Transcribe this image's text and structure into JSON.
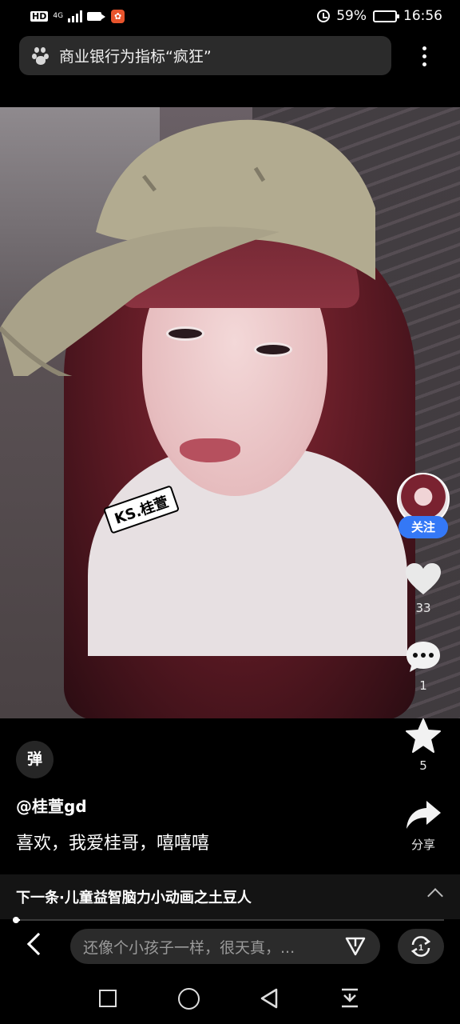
{
  "status_bar": {
    "hd_label": "HD",
    "network_label": "4G",
    "battery": "59%",
    "battery_level": 0.59,
    "time": "16:56"
  },
  "search": {
    "query": "商业银行为指标“疯狂”"
  },
  "video": {
    "sticker_text": "KS.桂萱",
    "eye_tag": "桂萱"
  },
  "rail": {
    "follow_label": "关注",
    "likes": "33",
    "comments": "1",
    "favorites": "5",
    "share_label": "分享"
  },
  "caption": {
    "danmaku_label": "弹",
    "author": "@桂萱gd",
    "text": "喜欢，我爱桂哥，嘻嘻嘻"
  },
  "next_up": {
    "label": "下一条·儿童益智脑力小动画之土豆人",
    "progress": 0.01
  },
  "comment_bar": {
    "placeholder": "还像个小孩子一样，很天真，..."
  },
  "colors": {
    "accent": "#3478f6",
    "background": "#000000"
  }
}
